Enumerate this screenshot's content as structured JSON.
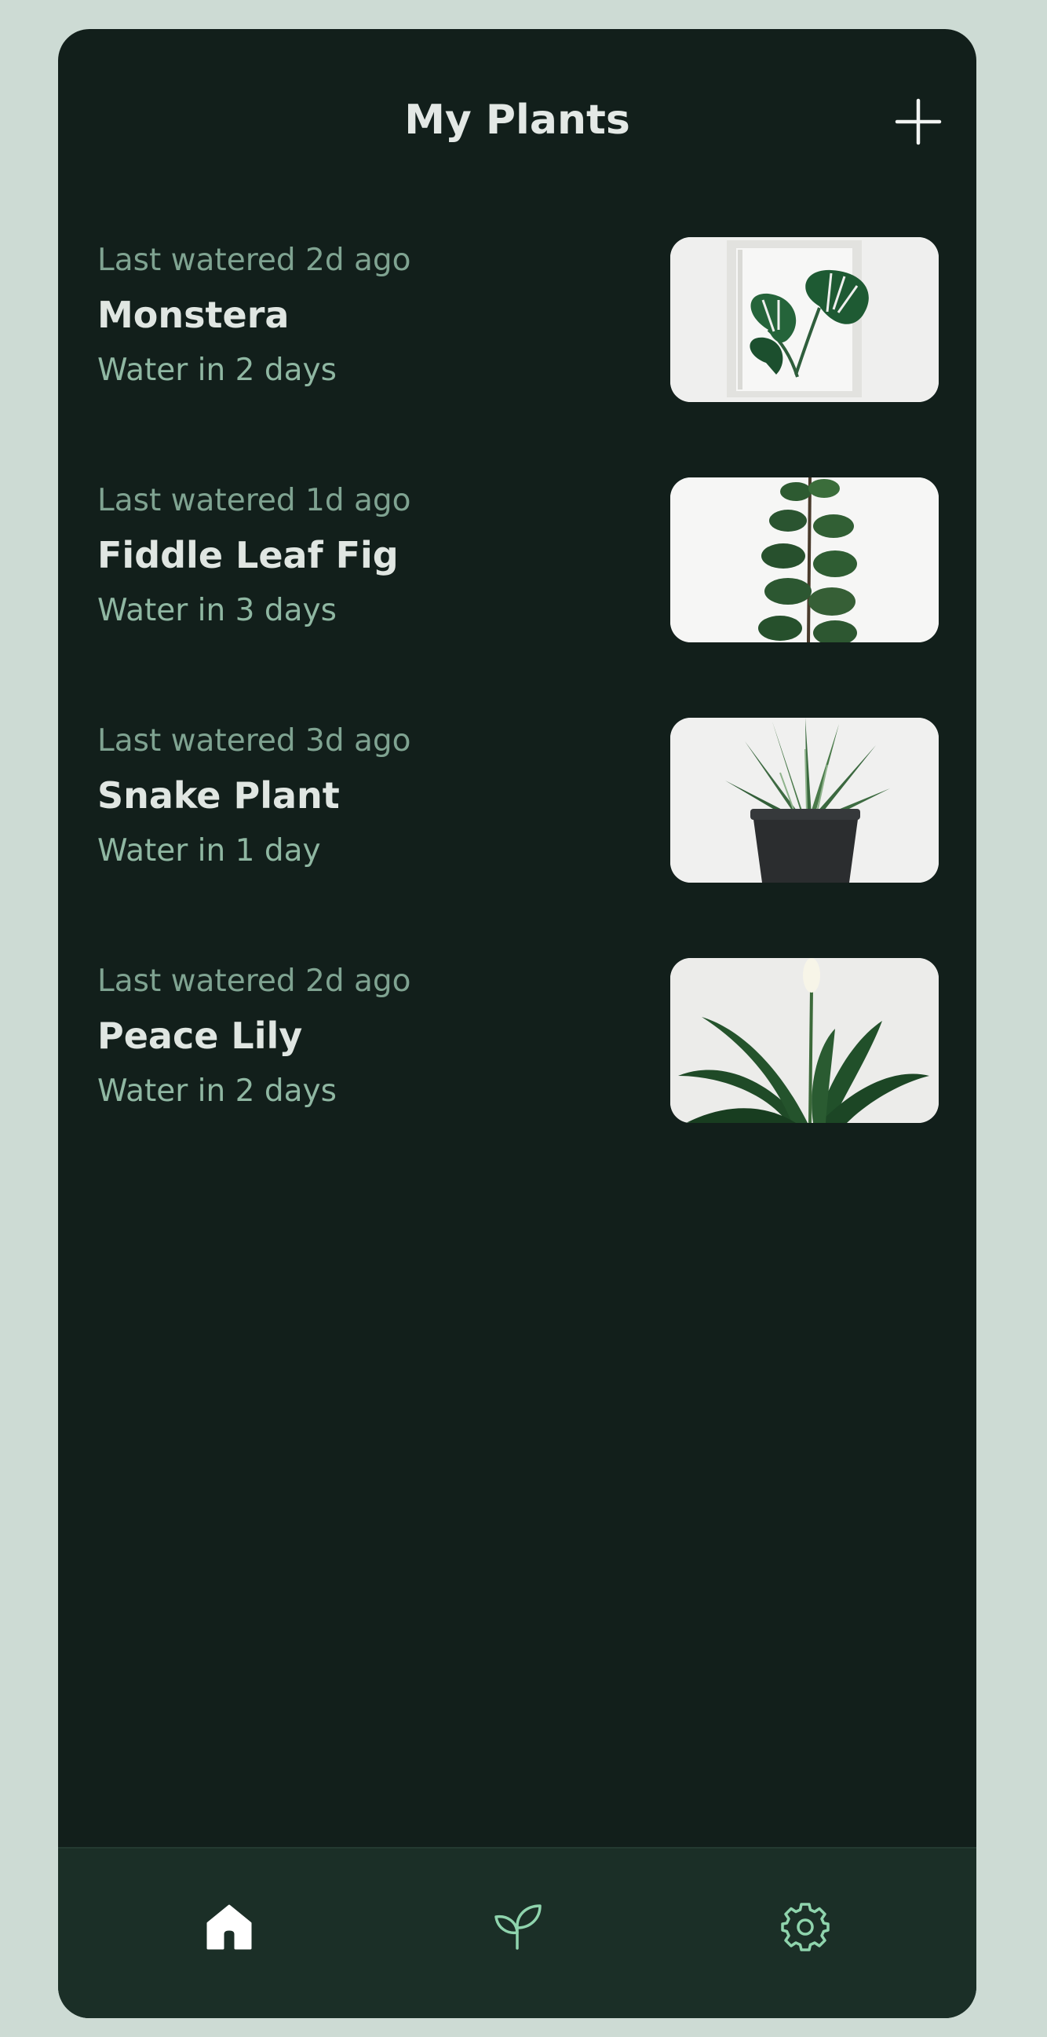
{
  "header": {
    "title": "My Plants",
    "add_icon": "plus-icon"
  },
  "plants": [
    {
      "last_watered": "Last watered 2d ago",
      "name": "Monstera",
      "next_water": "Water in 2 days",
      "image": "monstera-photo"
    },
    {
      "last_watered": "Last watered 1d ago",
      "name": "Fiddle Leaf Fig",
      "next_water": "Water in 3 days",
      "image": "fiddle-leaf-fig-photo"
    },
    {
      "last_watered": "Last watered 3d ago",
      "name": "Snake Plant",
      "next_water": "Water in 1 day",
      "image": "snake-plant-photo"
    },
    {
      "last_watered": "Last watered 2d ago",
      "name": "Peace Lily",
      "next_water": "Water in 2 days",
      "image": "peace-lily-photo"
    }
  ],
  "nav": {
    "items": [
      {
        "icon": "home-icon",
        "active": true
      },
      {
        "icon": "sprout-icon",
        "active": false
      },
      {
        "icon": "gear-icon",
        "active": false
      }
    ]
  },
  "colors": {
    "background": "#cddbd4",
    "surface": "#121f1b",
    "nav_bar": "#1b2f27",
    "accent": "#8fd4ad",
    "muted_text": "#7fa391"
  }
}
